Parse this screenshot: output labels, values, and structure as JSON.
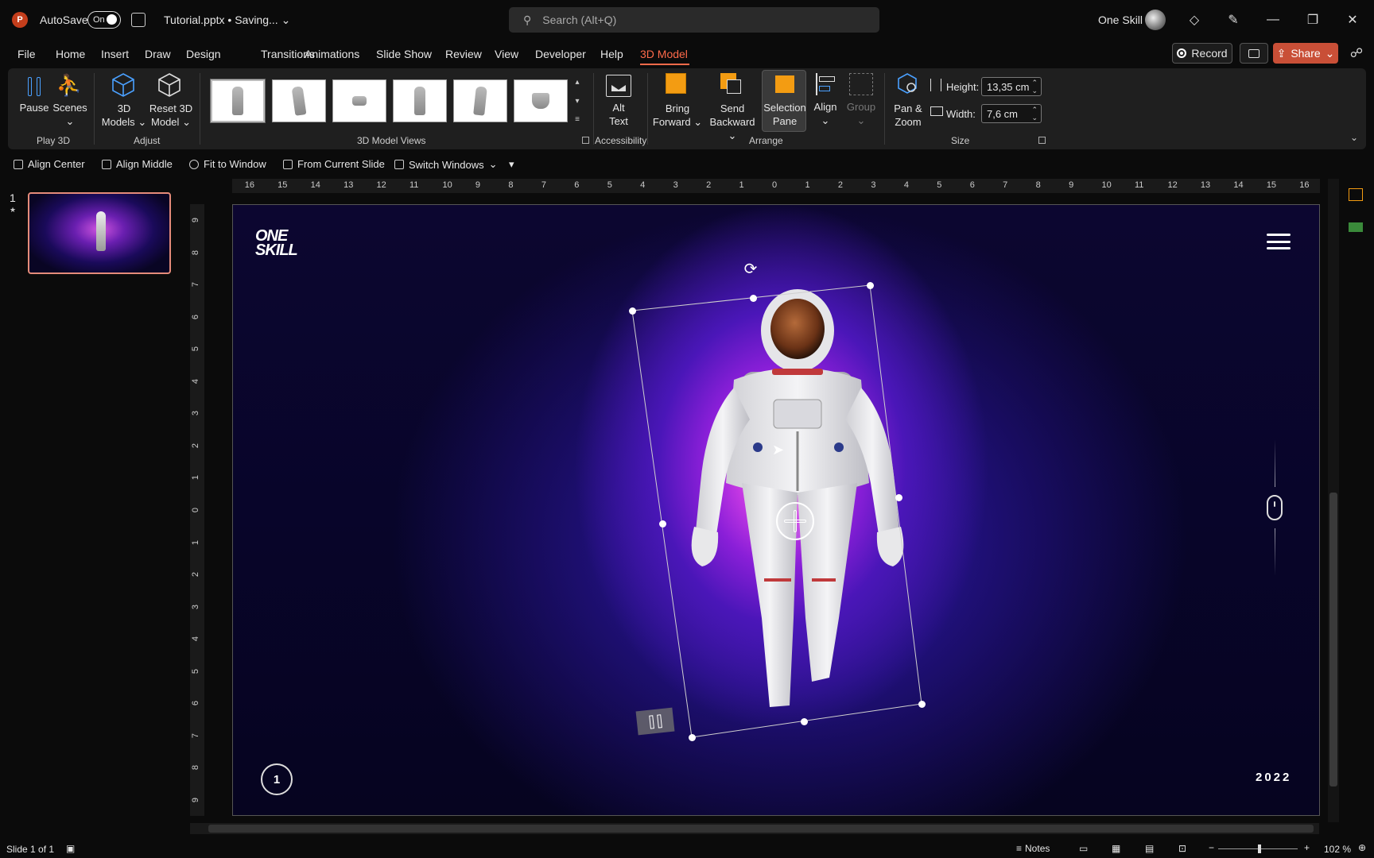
{
  "titlebar": {
    "app_letter": "P",
    "autosave_label": "AutoSave",
    "autosave_state": "On",
    "doc_title": "Tutorial.pptx • Saving...",
    "search_placeholder": "Search (Alt+Q)",
    "user_name": "One Skill"
  },
  "menu": {
    "items": [
      "File",
      "Home",
      "Insert",
      "Draw",
      "Design",
      "Transitions",
      "Animations",
      "Slide Show",
      "Review",
      "View",
      "Developer",
      "Help",
      "3D Model"
    ],
    "active": "3D Model",
    "record_label": "Record",
    "share_label": "Share"
  },
  "ribbon": {
    "play3d": {
      "pause": "Pause",
      "scenes": "Scenes",
      "group": "Play 3D"
    },
    "adjust": {
      "models_l1": "3D",
      "models_l2": "Models",
      "reset_l1": "Reset 3D",
      "reset_l2": "Model",
      "group": "Adjust"
    },
    "views": {
      "group": "3D Model Views"
    },
    "accessibility": {
      "alt_l1": "Alt",
      "alt_l2": "Text",
      "group": "Accessibility"
    },
    "arrange": {
      "bring_l1": "Bring",
      "bring_l2": "Forward",
      "send_l1": "Send",
      "send_l2": "Backward",
      "sel_l1": "Selection",
      "sel_l2": "Pane",
      "align": "Align",
      "group_btn": "Group",
      "group": "Arrange"
    },
    "size": {
      "pan_l1": "Pan &",
      "pan_l2": "Zoom",
      "height_label": "Height:",
      "height_value": "13,35 cm",
      "width_label": "Width:",
      "width_value": "7,6 cm",
      "group": "Size"
    }
  },
  "qat": {
    "align_center": "Align Center",
    "align_middle": "Align Middle",
    "fit_window": "Fit to Window",
    "from_current": "From Current Slide",
    "switch_windows": "Switch Windows"
  },
  "thumbnails": {
    "slide_number": "1"
  },
  "ruler": {
    "h_ticks": [
      "16",
      "15",
      "14",
      "13",
      "12",
      "11",
      "10",
      "9",
      "8",
      "7",
      "6",
      "5",
      "4",
      "3",
      "2",
      "1",
      "0",
      "1",
      "2",
      "3",
      "4",
      "5",
      "6",
      "7",
      "8",
      "9",
      "10",
      "11",
      "12",
      "13",
      "14",
      "15",
      "16"
    ],
    "v_ticks": [
      "9",
      "8",
      "7",
      "6",
      "5",
      "4",
      "3",
      "2",
      "1",
      "0",
      "1",
      "2",
      "3",
      "4",
      "5",
      "6",
      "7",
      "8",
      "9"
    ]
  },
  "slide": {
    "logo_l1": "ONE",
    "logo_l2": "SKILL",
    "page_number": "1",
    "year": "2022"
  },
  "status": {
    "slide_info": "Slide 1 of 1",
    "notes": "Notes",
    "zoom": "102 %"
  },
  "colors": {
    "accent": "#ff6a4a",
    "share": "#c94f37",
    "ribbon_bg": "#1f1f1f"
  }
}
